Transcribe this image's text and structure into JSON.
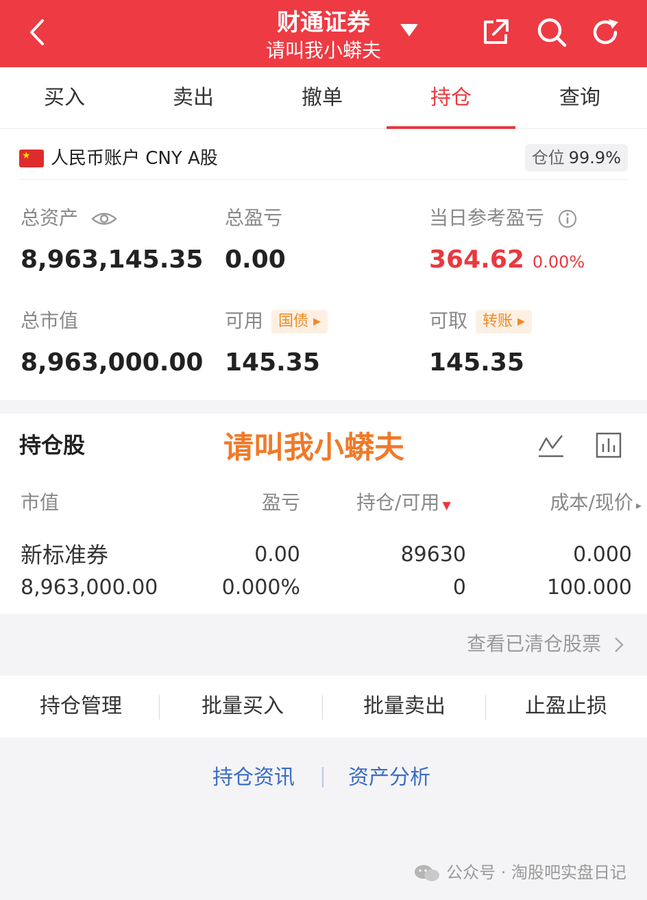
{
  "header": {
    "title": "财通证券",
    "subtitle": "请叫我小蟒夫",
    "bg_color": "#ee3a43"
  },
  "tabs": [
    {
      "label": "买入",
      "active": false
    },
    {
      "label": "卖出",
      "active": false
    },
    {
      "label": "撤单",
      "active": false
    },
    {
      "label": "持仓",
      "active": true
    },
    {
      "label": "查询",
      "active": false
    }
  ],
  "account": {
    "name": "人民币账户 CNY A股",
    "position_ratio_label": "仓位",
    "position_ratio_value": "99.9%",
    "total_assets_label": "总资产",
    "total_assets": "8,963,145.35",
    "total_pl_label": "总盈亏",
    "total_pl": "0.00",
    "daily_pl_label": "当日参考盈亏",
    "daily_pl": "364.62",
    "daily_pl_pct": "0.00%",
    "market_value_label": "总市值",
    "market_value": "8,963,000.00",
    "available_label": "可用",
    "available_tag": "国债",
    "available": "145.35",
    "withdrawable_label": "可取",
    "withdrawable_tag": "转账",
    "withdrawable": "145.35"
  },
  "holdings": {
    "title": "持仓股",
    "watermark": "请叫我小蟒夫",
    "columns": {
      "market_value": "市值",
      "pl": "盈亏",
      "position": "持仓/可用",
      "cost": "成本/现价"
    },
    "rows": [
      {
        "name": "新标准券",
        "market_value": "8,963,000.00",
        "pl": "0.00",
        "pl_pct": "0.000%",
        "position": "89630",
        "available": "0",
        "cost": "0.000",
        "price": "100.000"
      }
    ],
    "cleared_link": "查看已清仓股票"
  },
  "actions": [
    "持仓管理",
    "批量买入",
    "批量卖出",
    "止盈止损"
  ],
  "links": [
    "持仓资讯",
    "资产分析"
  ],
  "footer": {
    "text": "公众号 · 淘股吧实盘日记"
  },
  "colors": {
    "accent_red": "#e8393f",
    "tag_orange": "#f08a24",
    "link_blue": "#3a6cc6",
    "watermark_orange": "#ef7a2a"
  }
}
